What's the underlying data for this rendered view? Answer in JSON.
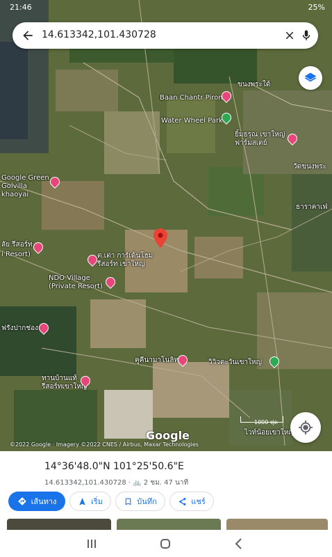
{
  "status_bar": {
    "time": "21:46",
    "battery": "25%"
  },
  "search": {
    "query": "14.613342,101.430728"
  },
  "map_labels": [
    {
      "text": "Baan Chantr Pirom"
    },
    {
      "text": "Water Wheel Park"
    },
    {
      "text": "ขนงพระใต้"
    },
    {
      "text": "ยิ้มธรุณ เขาใหญ่ ฟาร์มสเตย์"
    },
    {
      "text": "วัดขนงพระ"
    },
    {
      "text": "ธาราคาเฟ่"
    },
    {
      "text": "Google Green Golvilla khaoyai"
    },
    {
      "text": "ลัย รีสอร์ท"
    },
    {
      "text": "i Resort)"
    },
    {
      "text": "ต.เต่า การ์เด้นโฮม รีสอร์ท เขาใหญ่"
    },
    {
      "text": "NDO Village (Private Resort)"
    },
    {
      "text": "ฟรังปากช่อง"
    },
    {
      "text": "คูคีนามาโนลิท"
    },
    {
      "text": "วิวิวตะวันเขาใหญ่"
    },
    {
      "text": "ทานบ้านแท้ รีสอร์ทเขาใหญ่"
    },
    {
      "text": "ไวท์น้อยเขาใหญ่"
    }
  ],
  "google_logo": "Google",
  "credits": "©2022 Google · Imagery ©2022 CNES / Airbus, Maxar Technologies",
  "scale": "1000 ฟุต",
  "place": {
    "dms": "14°36'48.0\"N 101°25'50.6\"E",
    "details": "14.613342,101.430728 · 🚲 2 ชม. 47 นาที"
  },
  "actions": [
    {
      "label": "เส้นทาง"
    },
    {
      "label": "เริ่ม"
    },
    {
      "label": "บันทึก"
    },
    {
      "label": "แชร์"
    }
  ],
  "colors": {
    "accent": "#1a73e8",
    "pin_red": "#ea4335",
    "poi_pink": "#e8457a"
  }
}
